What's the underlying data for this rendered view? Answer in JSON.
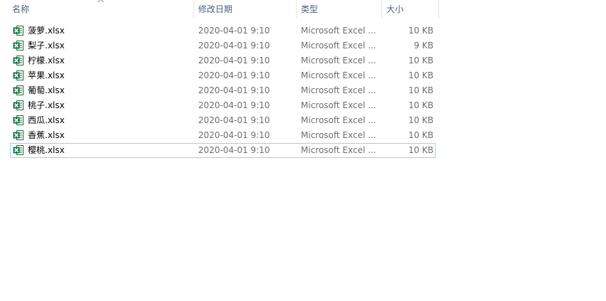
{
  "columns": {
    "name": "名称",
    "date": "修改日期",
    "type": "类型",
    "size": "大小"
  },
  "sort_indicator": "chevron-up-icon",
  "file_icon": "excel-file-icon",
  "colors": {
    "excel_green": "#1d7044",
    "header_text": "#4c607a",
    "detail_text": "#6d6d6d",
    "focus_border": "#99d1ff"
  },
  "files": [
    {
      "name": "菠萝.xlsx",
      "date": "2020-04-01 9:10",
      "type": "Microsoft Excel ...",
      "size": "10 KB"
    },
    {
      "name": "梨子.xlsx",
      "date": "2020-04-01 9:10",
      "type": "Microsoft Excel ...",
      "size": "9 KB"
    },
    {
      "name": "柠檬.xlsx",
      "date": "2020-04-01 9:10",
      "type": "Microsoft Excel ...",
      "size": "10 KB"
    },
    {
      "name": "苹果.xlsx",
      "date": "2020-04-01 9:10",
      "type": "Microsoft Excel ...",
      "size": "10 KB"
    },
    {
      "name": "葡萄.xlsx",
      "date": "2020-04-01 9:10",
      "type": "Microsoft Excel ...",
      "size": "10 KB"
    },
    {
      "name": "桃子.xlsx",
      "date": "2020-04-01 9:10",
      "type": "Microsoft Excel ...",
      "size": "10 KB"
    },
    {
      "name": "西瓜.xlsx",
      "date": "2020-04-01 9:10",
      "type": "Microsoft Excel ...",
      "size": "10 KB"
    },
    {
      "name": "香蕉.xlsx",
      "date": "2020-04-01 9:10",
      "type": "Microsoft Excel ...",
      "size": "10 KB"
    },
    {
      "name": "樱桃.xlsx",
      "date": "2020-04-01 9:10",
      "type": "Microsoft Excel ...",
      "size": "10 KB"
    }
  ]
}
